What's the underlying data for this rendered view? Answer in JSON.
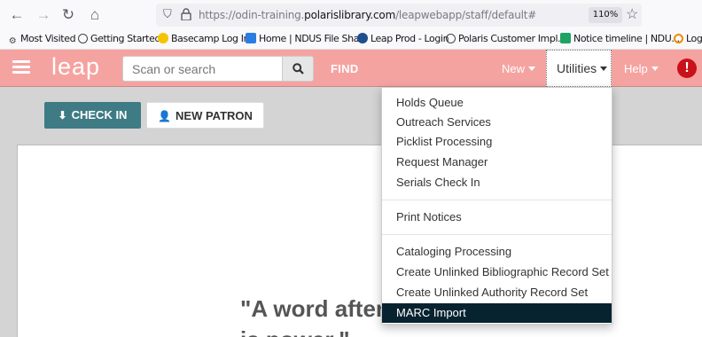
{
  "browser": {
    "url_prefix": "https://odin-training.",
    "url_domain": "polarislibrary.com",
    "url_suffix": "/leapwebapp/staff/default#",
    "zoom": "110%",
    "bookmarks": [
      {
        "label": "Most Visited",
        "icon": "gear-icon"
      },
      {
        "label": "Getting Started",
        "icon": "globe-icon"
      },
      {
        "label": "Basecamp Log In",
        "icon": "basecamp-icon"
      },
      {
        "label": "Home | NDUS File Sha...",
        "icon": "cloud-icon"
      },
      {
        "label": "Leap Prod - Login",
        "icon": "leap-icon"
      },
      {
        "label": "Polaris Customer Impl...",
        "icon": "globe-icon"
      },
      {
        "label": "Notice timeline | NDU...",
        "icon": "sheet-icon"
      },
      {
        "label": "Logi",
        "icon": "ring-icon"
      }
    ]
  },
  "header": {
    "logo": "leap",
    "search_placeholder": "Scan or search",
    "find_label": "FIND",
    "new_label": "New",
    "utilities_label": "Utilities",
    "help_label": "Help",
    "alert_glyph": "!"
  },
  "actions": {
    "checkin_label": "CHECK IN",
    "new_patron_label": "NEW PATRON"
  },
  "utilities_menu": {
    "group1": [
      "Holds Queue",
      "Outreach Services",
      "Picklist Processing",
      "Request Manager",
      "Serials Check In"
    ],
    "group2": [
      "Print Notices"
    ],
    "group3": [
      "Cataloging Processing",
      "Create Unlinked Bibliographic Record Set",
      "Create Unlinked Authority Record Set",
      "MARC Import"
    ]
  },
  "quote": {
    "line1": "\"A word after",
    "line2": "is power.\""
  },
  "colors": {
    "header_bg": "#f5a3a1",
    "checkin_bg": "#3e7b85",
    "menu_active_bg": "#072330",
    "alert": "#c9111a"
  }
}
